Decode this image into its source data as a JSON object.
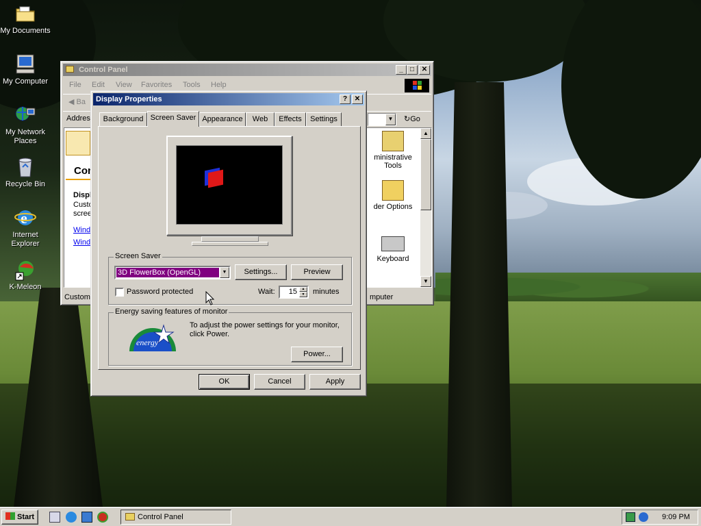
{
  "desktop": {
    "icons": [
      {
        "label": "My Documents",
        "icon": "folder-documents-icon"
      },
      {
        "label": "My Computer",
        "icon": "computer-icon"
      },
      {
        "label": "My Network Places",
        "icon": "network-icon"
      },
      {
        "label": "Recycle Bin",
        "icon": "recycle-bin-icon"
      },
      {
        "label": "Internet Explorer",
        "icon": "internet-explorer-icon"
      },
      {
        "label": "K-Meleon",
        "icon": "k-meleon-icon"
      }
    ]
  },
  "control_panel": {
    "title": "Control Panel",
    "menu": [
      "File",
      "Edit",
      "View",
      "Favorites",
      "Tools",
      "Help"
    ],
    "back_label": "Ba",
    "address_label": "Addres",
    "go_label": "Go",
    "left_heading": "Con",
    "left_title": "Displ",
    "left_desc": [
      "Custo",
      "scree"
    ],
    "left_links": [
      "Windo",
      "Windo"
    ],
    "items": [
      "ministrative Tools",
      "der Options",
      "Keyboard"
    ],
    "status_left": "Customi",
    "status_right": "mputer"
  },
  "display_properties": {
    "title": "Display Properties",
    "help_btn": "?",
    "close_btn": "✕",
    "tabs": [
      "Background",
      "Screen Saver",
      "Appearance",
      "Web",
      "Effects",
      "Settings"
    ],
    "selected_tab": "Screen Saver",
    "screensaver_group_label": "Screen Saver",
    "screensaver_selected": "3D FlowerBox (OpenGL)",
    "settings_btn": "Settings...",
    "preview_btn": "Preview",
    "password_label": "Password protected",
    "password_checked": false,
    "wait_label": "Wait:",
    "wait_value": "15",
    "minutes_label": "minutes",
    "energy_group_label": "Energy saving features of monitor",
    "energy_text": "To adjust the power settings for your monitor, click Power.",
    "energy_logo_text": "energy",
    "power_btn": "Power...",
    "ok_btn": "OK",
    "cancel_btn": "Cancel",
    "apply_btn": "Apply"
  },
  "taskbar": {
    "start_label": "Start",
    "task_label": "Control Panel",
    "clock": "9:09 PM"
  }
}
